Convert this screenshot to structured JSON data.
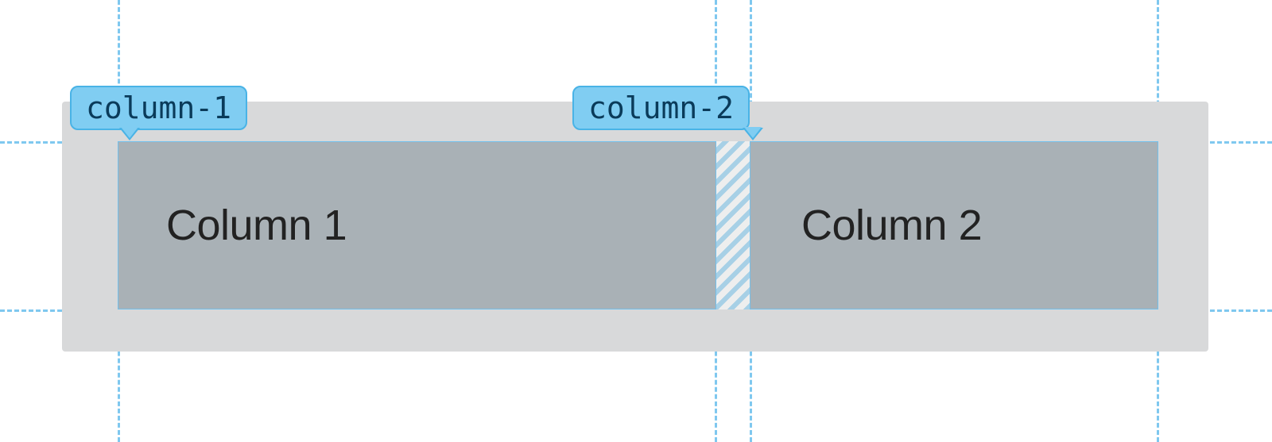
{
  "labels": {
    "col1_name": "column-1",
    "col2_name": "column-2"
  },
  "columns": {
    "col1_text": "Column 1",
    "col2_text": "Column 2"
  }
}
